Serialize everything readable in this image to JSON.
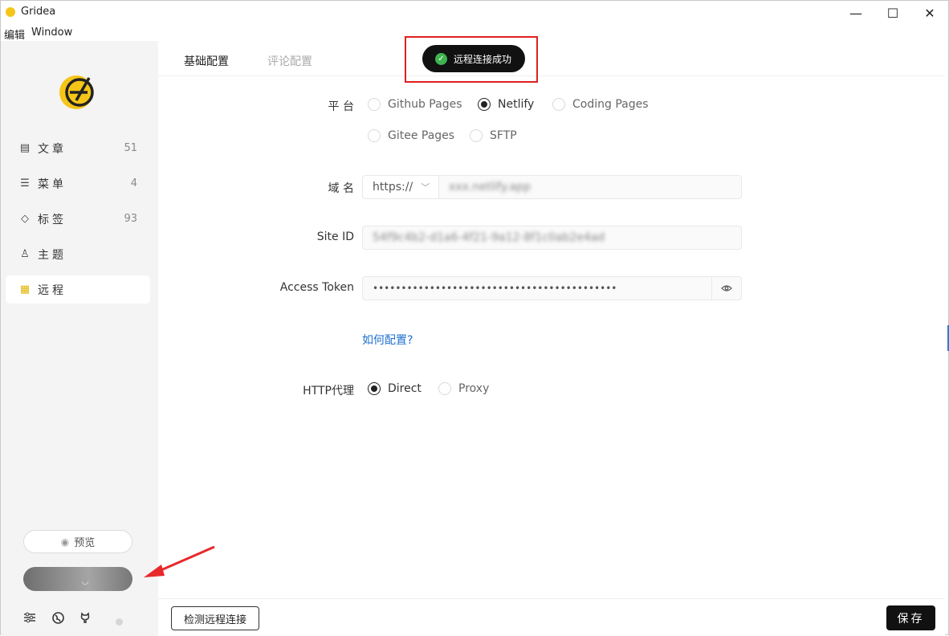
{
  "app": {
    "title": "Gridea"
  },
  "window_controls": {
    "minimize": "—",
    "maximize": "☐",
    "close": "✕"
  },
  "menu": {
    "items": [
      "编辑",
      "Window"
    ]
  },
  "sidebar": {
    "items": [
      {
        "label": "文章",
        "count": "51",
        "icon": "article-icon"
      },
      {
        "label": "菜单",
        "count": "4",
        "icon": "menu-icon"
      },
      {
        "label": "标签",
        "count": "93",
        "icon": "tag-icon"
      },
      {
        "label": "主题",
        "count": "",
        "icon": "shirt-icon"
      },
      {
        "label": "远程",
        "count": "",
        "icon": "remote-icon"
      }
    ],
    "preview_label": "预览",
    "sync_state": "syncing"
  },
  "tabs": [
    {
      "label": "基础配置",
      "active": true
    },
    {
      "label": "评论配置",
      "active": false
    }
  ],
  "toast": {
    "message": "远程连接成功",
    "status": "success"
  },
  "form": {
    "platform": {
      "label": "平 台",
      "options": [
        "Github Pages",
        "Netlify",
        "Coding Pages",
        "Gitee Pages",
        "SFTP"
      ],
      "selected": "Netlify"
    },
    "domain": {
      "label": "域 名",
      "protocol": "https://",
      "value": "xxx.netlify.app"
    },
    "site_id": {
      "label": "Site ID",
      "value": "54f9c4b2-d1a6-4f21-9a12-8f1c0ab2e4ad"
    },
    "access_token": {
      "label": "Access Token",
      "value": "•••••••••••••••••••••••••••••••••••••••••••"
    },
    "help_link": "如何配置?",
    "http_proxy": {
      "label": "HTTP代理",
      "options": [
        "Direct",
        "Proxy"
      ],
      "selected": "Direct"
    }
  },
  "footer": {
    "check_label": "检测远程连接",
    "save_label": "保存"
  },
  "colors": {
    "accent": "#f5c518",
    "highlight_box": "#e02020",
    "success": "#3fb34f",
    "link": "#1f6fcf"
  }
}
